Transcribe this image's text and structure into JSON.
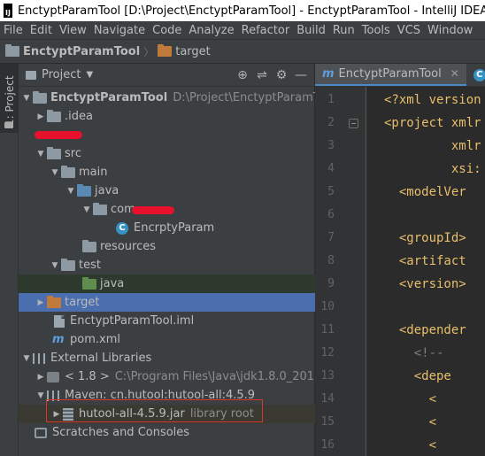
{
  "window": {
    "title": "EnctyptParamTool [D:\\Project\\EnctyptParamTool] - EnctyptParamTool - IntelliJ IDEA",
    "logo_text": "IJ"
  },
  "menu": [
    "File",
    "Edit",
    "View",
    "Navigate",
    "Code",
    "Analyze",
    "Refactor",
    "Build",
    "Run",
    "Tools",
    "VCS",
    "Window"
  ],
  "breadcrumb": {
    "project": "EnctyptParamTool",
    "folder": "target"
  },
  "sidestrip": {
    "tab_label": "1: Project"
  },
  "project_panel": {
    "title": "Project",
    "tree": {
      "root_name": "EnctyptParamTool",
      "root_path": "D:\\Project\\EnctyptParamTool",
      "idea": ".idea",
      "src": "src",
      "main": "main",
      "java": "java",
      "com": "com",
      "class_file": "EncrptyParam",
      "resources": "resources",
      "test": "test",
      "test_java": "java",
      "target": "target",
      "iml": "EnctyptParamTool.iml",
      "pom": "pom.xml",
      "external_libraries": "External Libraries",
      "jdk_label": "< 1.8 >",
      "jdk_path": "C:\\Program Files\\Java\\jdk1.8.0_201",
      "maven_lib": "Maven: cn.hutool:hutool-all:4.5.9",
      "jar": "hutool-all-4.5.9.jar",
      "jar_note": "library root",
      "scratches": "Scratches and Consoles"
    }
  },
  "editor": {
    "tabs": [
      {
        "label": "EnctyptParamTool",
        "active": true
      },
      {
        "label": "En",
        "active": false
      }
    ],
    "line_numbers": [
      "1",
      "2",
      "3",
      "4",
      "5",
      "6",
      "7",
      "8",
      "9",
      "10",
      "11",
      "12",
      "13",
      "14",
      "15",
      "16"
    ],
    "lines": [
      "<?xml version",
      "<project xmlr",
      "         xmlr",
      "         xsi:",
      "  <modelVer",
      "",
      "  <groupId>",
      "  <artifact",
      "  <version>",
      "",
      "  <depender",
      "    <!--",
      "    <depe",
      "      <",
      "      <",
      "      <"
    ]
  },
  "colors": {
    "selection": "#4b6eaf",
    "annotation_box": "#d8382a",
    "redaction": "#e8112d",
    "xml_tag": "#e8bf6a"
  }
}
